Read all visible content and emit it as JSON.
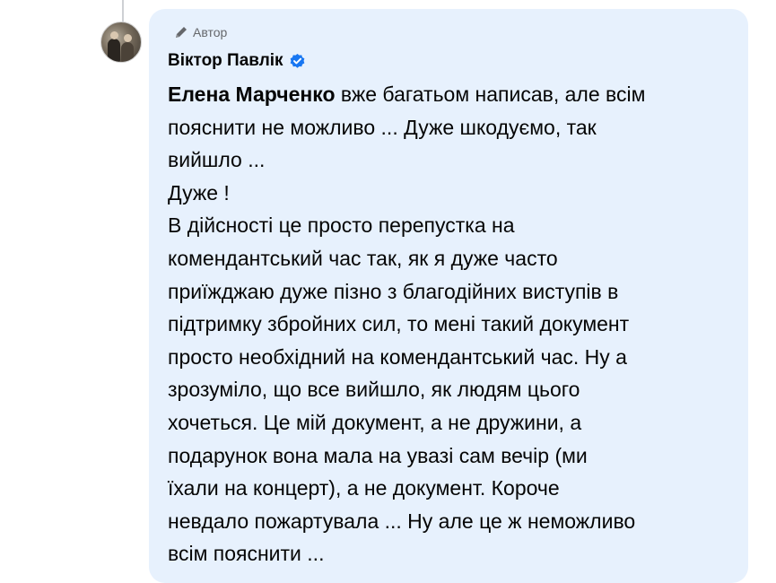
{
  "comment": {
    "badge_label": "Автор",
    "author_name": "Віктор Павлік",
    "mention": "Елена Марченко",
    "lines": [
      " вже багатьом написав, але всім",
      "пояснити не можливо ... Дуже шкодуємо, так",
      "вийшло ...",
      "Дуже !",
      "В дійсності це просто перепустка на",
      "комендантський час так, як я дуже часто",
      "приїжджаю дуже пізно з благодійних виступів в",
      "підтримку збройних сил, то мені такий документ",
      "просто необхідний на комендантський час. Ну а",
      "зрозуміло, що все вийшло, як людям цього",
      "хочеться. Це мій документ, а не дружини, а",
      "подарунок вона мала на увазі сам вечір (ми",
      "їхали на концерт), а не документ. Короче",
      "невдало пожартувала ... Ну але це ж неможливо",
      "всім пояснити ..."
    ]
  },
  "icons": {
    "badge": "pencil-icon",
    "verified": "verified-badge-icon",
    "avatar": "avatar"
  },
  "colors": {
    "bubble_background": "#e7f1fd",
    "verified_blue": "#1877f2",
    "secondary_text": "#65676b",
    "primary_text": "#050505"
  }
}
